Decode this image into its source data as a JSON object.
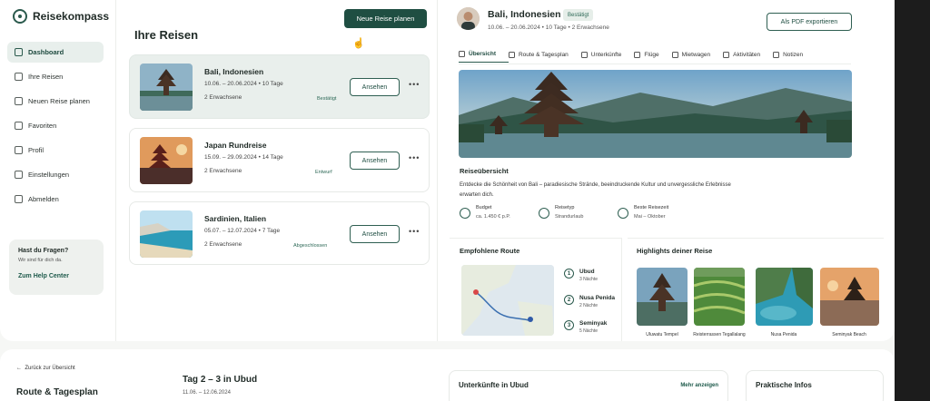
{
  "app": {
    "name": "Reisekompass"
  },
  "sidebar": {
    "items": [
      {
        "label": "Dashboard",
        "icon": "home-icon",
        "active": true
      },
      {
        "label": "Ihre Reisen",
        "icon": "calendar-icon"
      },
      {
        "label": "Neuen Reise planen",
        "icon": "plane-icon"
      },
      {
        "label": "Favoriten",
        "icon": "heart-icon"
      },
      {
        "label": "Profil",
        "icon": "user-icon"
      },
      {
        "label": "Einstellungen",
        "icon": "gear-icon"
      },
      {
        "label": "Abmelden",
        "icon": "logout-icon"
      }
    ],
    "help": {
      "title": "Hast du Fragen?",
      "subtitle": "Wir sind für dich da.",
      "link": "Zum Help Center"
    }
  },
  "trips": {
    "title": "Ihre Reisen",
    "new_button": "Neue Reise planen",
    "list": [
      {
        "name": "Bali, Indonesien",
        "dates": "10.06. – 20.06.2024  •  10 Tage",
        "pax": "2 Erwachsene",
        "status": "Bestätigt",
        "button": "Ansehen"
      },
      {
        "name": "Japan Rundreise",
        "dates": "15.09. – 29.09.2024  •  14 Tage",
        "pax": "2 Erwachsene",
        "status": "Entwurf",
        "button": "Ansehen"
      },
      {
        "name": "Sardinien, Italien",
        "dates": "05.07. – 12.07.2024  •  7 Tage",
        "pax": "2 Erwachsene",
        "status": "Abgeschlossen",
        "button": "Ansehen"
      }
    ]
  },
  "detail": {
    "title": "Bali, Indonesien",
    "badge": "Bestätigt",
    "subtitle": "10.06. – 20.06.2024  •  10 Tage  •  2 Erwachsene",
    "pdf_button": "Als PDF exportieren",
    "tabs": [
      "Übersicht",
      "Route & Tagesplan",
      "Unterkünfte",
      "Flüge",
      "Mietwagen",
      "Aktivitäten",
      "Notizen"
    ],
    "overview_title": "Reiseübersicht",
    "overview_desc": "Entdecke die Schönheit von Bali – paradiesische Strände, beeindruckende Kultur und unvergessliche Erlebnisse erwarten dich.",
    "facts": [
      {
        "label": "Budget",
        "value": "ca. 1.450 € p.P."
      },
      {
        "label": "Reisetyp",
        "value": "Strandurlaub"
      },
      {
        "label": "Beste Reisezeit",
        "value": "Mai – Oktober"
      }
    ],
    "route_title": "Empfohlene Route",
    "route": [
      {
        "n": "1",
        "name": "Ubud",
        "nights": "3 Nächte"
      },
      {
        "n": "2",
        "name": "Nusa Penida",
        "nights": "2 Nächte"
      },
      {
        "n": "3",
        "name": "Seminyak",
        "nights": "5 Nächte"
      }
    ],
    "highlights_title": "Highlights deiner Reise",
    "highlights": [
      "Uluwatu Tempel",
      "Reisterrassen Tegallalang",
      "Nusa Penida",
      "Seminyak Beach"
    ]
  },
  "bottom": {
    "back": "Zurück zur Übersicht",
    "section_title": "Route & Tagesplan",
    "day_title": "Tag 2 – 3  in Ubud",
    "day_sub": "11.06. – 12.06.2024",
    "stay_title": "Unterkünfte in Ubud",
    "more": "Mehr anzeigen",
    "info_title": "Praktische Infos"
  }
}
